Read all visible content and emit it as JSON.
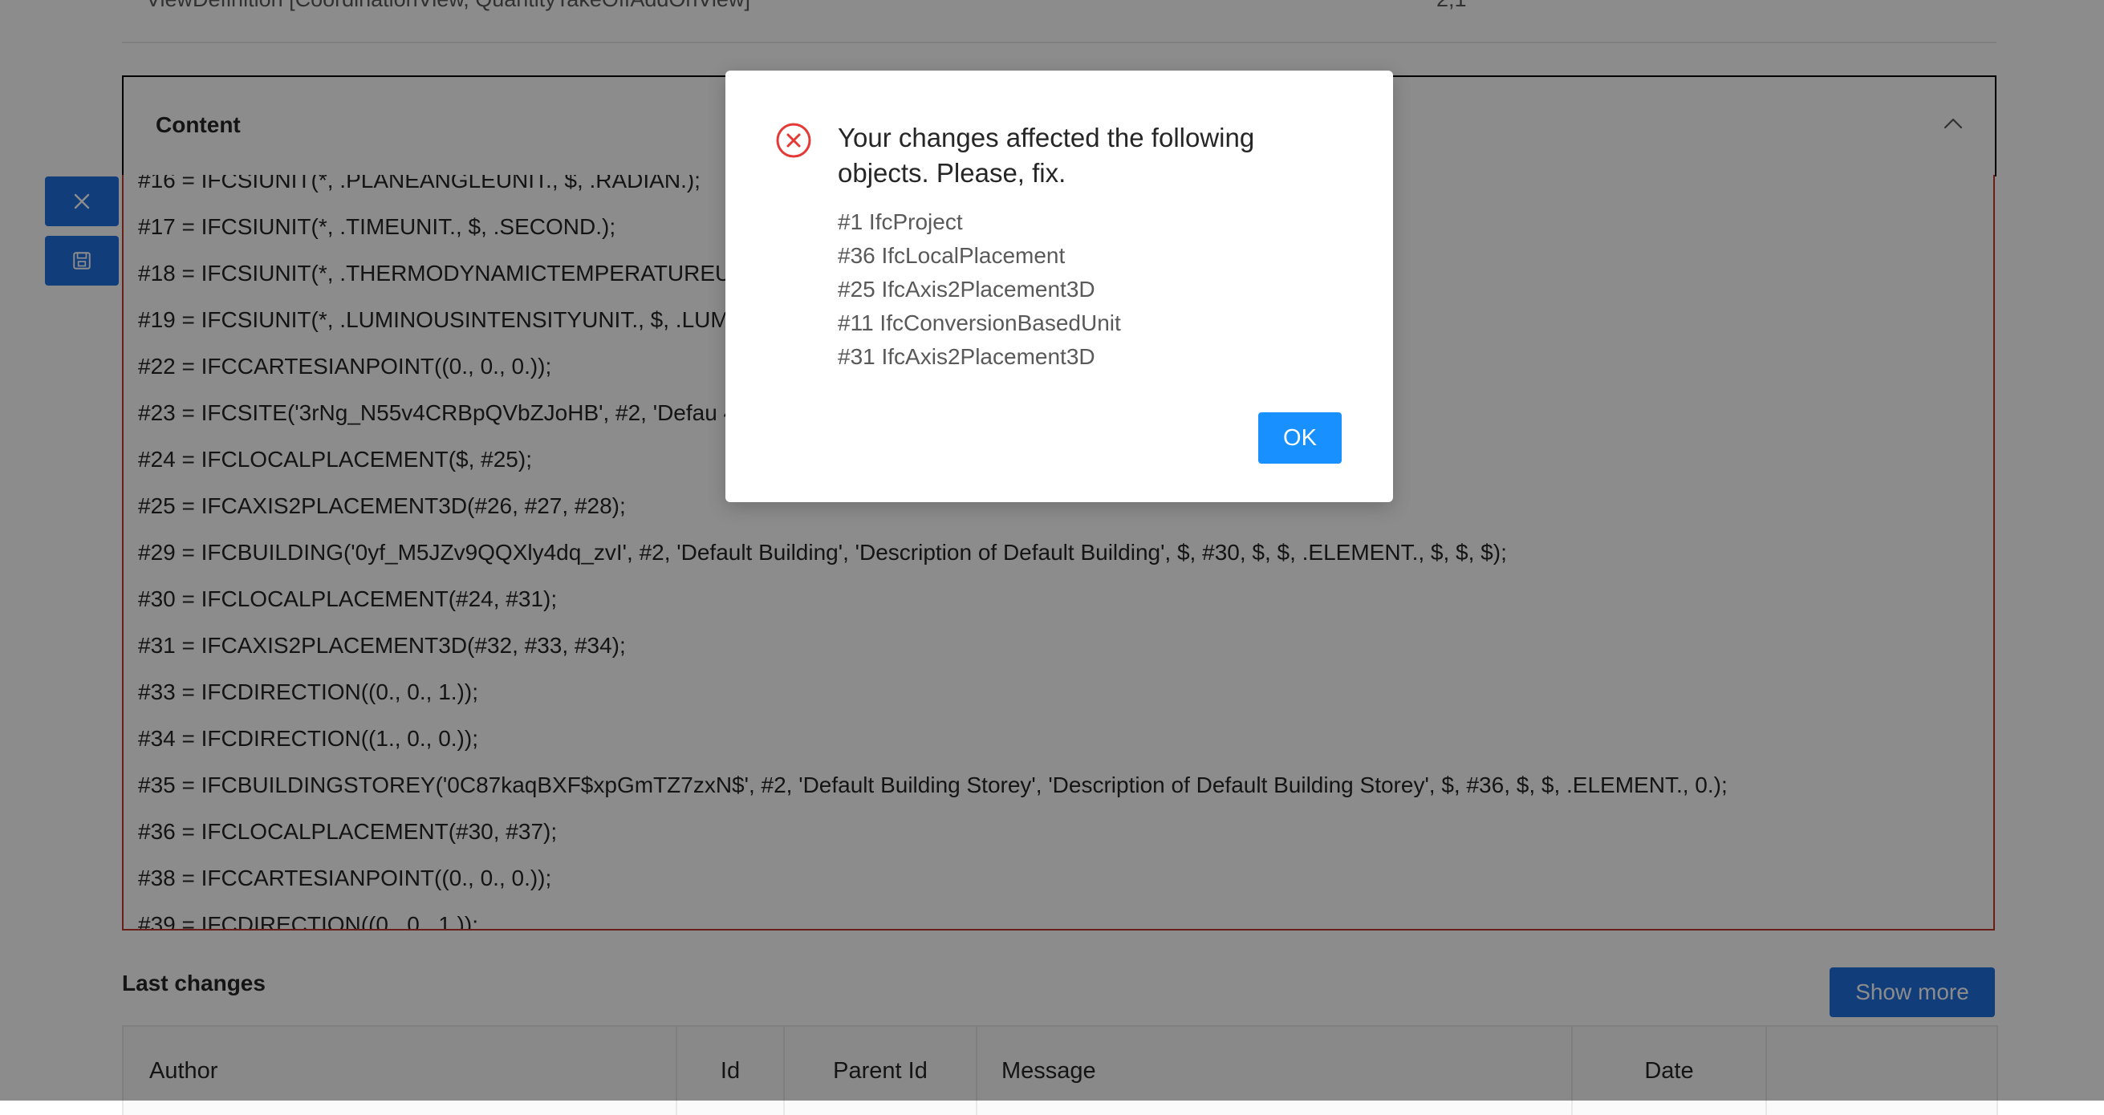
{
  "meta_row": {
    "label": "ViewDefinition [CoordinationView, QuantityTakeOffAddOnView]",
    "value": "2;1"
  },
  "side_actions": {
    "close_icon": "close-icon",
    "save_icon": "save-icon"
  },
  "content": {
    "title": "Content",
    "lines": [
      "#16 = IFCSIUNIT(*, .PLANEANGLEUNIT., $, .RADIAN.);",
      "#17 = IFCSIUNIT(*, .TIMEUNIT., $, .SECOND.);",
      "#18 = IFCSIUNIT(*, .THERMODYNAMICTEMPERATUREUN",
      "#19 = IFCSIUNIT(*, .LUMINOUSINTENSITYUNIT., $, .LUM",
      "#22 = IFCCARTESIANPOINT((0., 0., 0.));",
      "#23 = IFCSITE('3rNg_N55v4CRBpQVbZJoHB', #2, 'Defau                                                                                                              4, 28, 0), (54, 25, 0), $, $, $);",
      "#24 = IFCLOCALPLACEMENT($, #25);",
      "#25 = IFCAXIS2PLACEMENT3D(#26, #27, #28);",
      "#29 = IFCBUILDING('0yf_M5JZv9QQXly4dq_zvI', #2, 'Default Building', 'Description of Default Building', $, #30, $, $, .ELEMENT., $, $, $);",
      "#30 = IFCLOCALPLACEMENT(#24, #31);",
      "#31 = IFCAXIS2PLACEMENT3D(#32, #33, #34);",
      "#33 = IFCDIRECTION((0., 0., 1.));",
      "#34 = IFCDIRECTION((1., 0., 0.));",
      "#35 = IFCBUILDINGSTOREY('0C87kaqBXF$xpGmTZ7zxN$', #2, 'Default Building Storey', 'Description of Default Building Storey', $, #36, $, $, .ELEMENT., 0.);",
      "#36 = IFCLOCALPLACEMENT(#30, #37);",
      "#38 = IFCCARTESIANPOINT((0., 0., 0.));",
      "#39 = IFCDIRECTION((0., 0., 1.));"
    ]
  },
  "last_changes": {
    "title": "Last changes",
    "show_more": "Show more",
    "columns": [
      "Author",
      "Id",
      "Parent Id",
      "Message",
      "Date",
      ""
    ]
  },
  "modal": {
    "title": "Your changes affected the following objects. Please, fix.",
    "items": [
      "#1 IfcProject",
      "#36 IfcLocalPlacement",
      "#25 IfcAxis2Placement3D",
      "#11 IfcConversionBasedUnit",
      "#31 IfcAxis2Placement3D"
    ],
    "ok_label": "OK",
    "icon": "error-circle-icon"
  },
  "colors": {
    "primary": "#1f6fe0",
    "ok_button": "#1890ff",
    "error": "#e53935",
    "invalid_border": "#c0392b"
  }
}
